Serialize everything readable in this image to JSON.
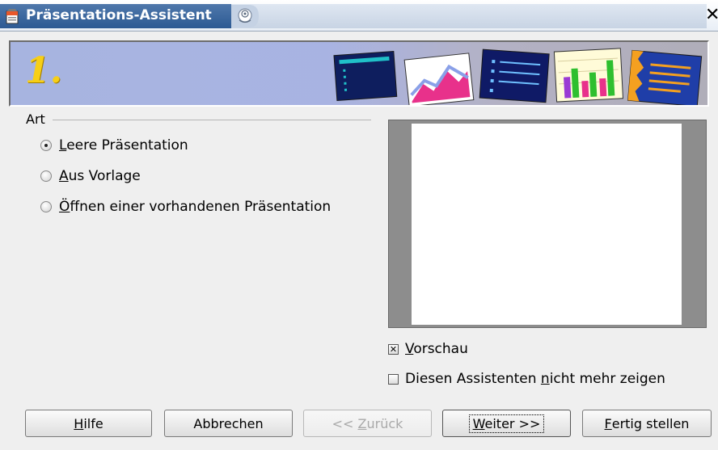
{
  "window": {
    "title": "Präsentations-Assistent",
    "close_glyph": "✕",
    "icons": [
      "app-icon",
      "window-menu-icon",
      "close-icon"
    ]
  },
  "banner": {
    "step": "1.",
    "art_icons": [
      "slide-outline-icon",
      "slide-chart-mountain-icon",
      "slide-bullets-icon",
      "slide-bar-chart-icon",
      "slide-lines-icon"
    ]
  },
  "art_group": {
    "label": "Art",
    "options": [
      {
        "mnemonic": "L",
        "rest": "eere Präsentation",
        "checked": true
      },
      {
        "mnemonic": "A",
        "rest": "us Vorlage",
        "checked": false
      },
      {
        "mnemonic": "Ö",
        "rest": "ffnen einer vorhandenen Präsentation",
        "checked": false
      }
    ]
  },
  "preview": {
    "checkbox_mnemonic": "V",
    "checkbox_rest": "orschau",
    "checked": true,
    "check_mark": "✕"
  },
  "dont_show": {
    "before": "Diesen Assistenten ",
    "mnemonic": "n",
    "after": "icht mehr zeigen",
    "checked": false
  },
  "buttons": {
    "help": {
      "mnemonic": "H",
      "rest": "ilfe"
    },
    "cancel": {
      "label": "Abbrechen"
    },
    "back": {
      "prefix": "<< ",
      "mnemonic": "Z",
      "rest": "urück",
      "enabled": false
    },
    "next": {
      "mnemonic": "W",
      "rest": "eiter >>"
    },
    "finish": {
      "mnemonic": "F",
      "rest": "ertig stellen"
    }
  }
}
